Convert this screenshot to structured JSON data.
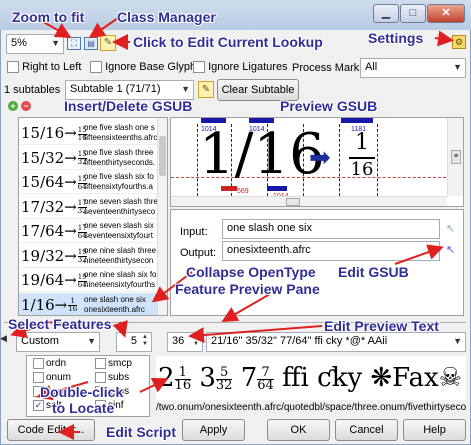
{
  "annotations": {
    "zoom_to_fit": "Zoom to fit",
    "class_manager": "Class Manager",
    "click_edit_lookup": "Click to Edit Current Lookup",
    "settings": "Settings",
    "insert_delete": "Insert/Delete GSUB",
    "preview_gsub": "Preview GSUB",
    "collapse_line1": "Collapse OpenType",
    "collapse_line2": "Feature Preview Pane",
    "edit_gsub": "Edit GSUB",
    "select_features": "Select Features",
    "edit_preview_text": "Edit Preview Text",
    "double_click_1": "Double-click",
    "double_click_2": "to Locate",
    "edit_script": "Edit Script"
  },
  "toolbar": {
    "zoom_value": "5%"
  },
  "options": {
    "right_to_left": "Right to Left",
    "ignore_base_glyphs": "Ignore Base Glyphs",
    "ignore_ligatures": "Ignore Ligatures",
    "process_marks_label": "Process Marks:",
    "process_marks_value": "All"
  },
  "subtable": {
    "count_label": "1 subtables",
    "selected": "Subtable 1 (71/71)",
    "clear_label": "Clear Subtable"
  },
  "gsub_list": [
    {
      "big": "15/16→",
      "sup": "15",
      "sub": "16",
      "line1": "one five slash one s",
      "line2": "fifteensixteenths.afrc"
    },
    {
      "big": "15/32→",
      "sup": "15",
      "sub": "32",
      "line1": "one five slash three",
      "line2": "fifteenthirtyseconds."
    },
    {
      "big": "15/64→",
      "sup": "15",
      "sub": "64",
      "line1": "one five slash six fo",
      "line2": "fifteensixtyfourths.a"
    },
    {
      "big": "17/32→",
      "sup": "17",
      "sub": "32",
      "line1": "one seven slash thre",
      "line2": "seventeenthirtyseco"
    },
    {
      "big": "17/64→",
      "sup": "17",
      "sub": "64",
      "line1": "one seven slash six",
      "line2": "seventeensixtyfourt"
    },
    {
      "big": "19/32→",
      "sup": "19",
      "sub": "32",
      "line1": "one nine slash three",
      "line2": "nineteenthirtysecon"
    },
    {
      "big": "19/64→",
      "sup": "19",
      "sub": "64",
      "line1": "one nine slash six fo",
      "line2": "nineteensixtyfourths"
    },
    {
      "big": "1/16→",
      "sup": "1",
      "sub": "16",
      "line1": "one slash one six",
      "line2": "onesixteenth.afrc"
    }
  ],
  "preview": {
    "input_glyphs": "1/16",
    "output_num": "1",
    "output_den": "16",
    "metric_1014_a": "1014",
    "metric_1014_b": "1014",
    "metric_1181": "1181",
    "metric_569": "569",
    "metric_1014_c": "1014"
  },
  "fields": {
    "input_label": "Input:",
    "input_value": "one slash one six",
    "output_label": "Output:",
    "output_value": "onesixteenth.afrc"
  },
  "features_panel": {
    "script_value": "Custom",
    "count_value": "5",
    "size_value": "36",
    "preview_text": "21/16\" 35/32\" 77/64\" ffi cky *@* AAii",
    "features": [
      {
        "tag": "ordn",
        "checked": false
      },
      {
        "tag": "smcp",
        "checked": false
      },
      {
        "tag": "onum",
        "checked": false
      },
      {
        "tag": "subs",
        "checked": false
      },
      {
        "tag": "pcap",
        "checked": false
      },
      {
        "tag": "sups",
        "checked": false
      },
      {
        "tag": "salt",
        "checked": true
      },
      {
        "tag": "sinf",
        "checked": false
      }
    ],
    "glyph_path": "/two.onum/onesixteenth.afrc/quotedbl/space/three.onum/fivethirtyseconds.afrc/q"
  },
  "bottom": {
    "code_editor": "Code Editor...",
    "apply": "Apply",
    "ok": "OK",
    "cancel": "Cancel",
    "help": "Help"
  },
  "colors": {
    "annotation": "#2f2f96",
    "arrow": "#e02020",
    "metric_blue": "#1818a8",
    "metric_red": "#cc2222",
    "selection": "#cfe3fb"
  }
}
